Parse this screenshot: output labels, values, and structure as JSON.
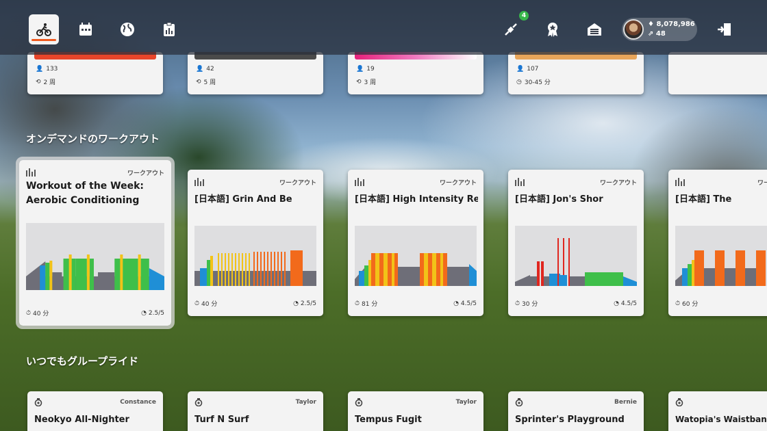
{
  "nav": {
    "notification_count": "4",
    "profile": {
      "drops": "8,078,986",
      "level": "48"
    }
  },
  "top_row": [
    {
      "participants": "133",
      "duration": "2 周",
      "strip_color": "#e8452a",
      "duration_icon": "repeat-icon"
    },
    {
      "participants": "42",
      "duration": "5 周",
      "strip_color": "#4a4a4a",
      "duration_icon": "repeat-icon"
    },
    {
      "participants": "19",
      "duration": "3 周",
      "strip_color": "#e6207a",
      "duration_icon": "repeat-icon"
    },
    {
      "participants": "107",
      "duration": "30-45 分",
      "strip_color": "#e8a55a",
      "duration_icon": "clock-icon"
    }
  ],
  "sections": {
    "workouts_title": "オンデマンドのワークアウト",
    "group_rides_title": "いつでもグループライド"
  },
  "workouts": [
    {
      "type": "ワークアウト",
      "title": "Workout of the Week: Aerobic Conditioning",
      "duration": "40 分",
      "difficulty": "2.5/5"
    },
    {
      "type": "ワークアウト",
      "title": "[日本語] Grin And Be",
      "duration": "40 分",
      "difficulty": "2.5/5"
    },
    {
      "type": "ワークアウト",
      "title": "[日本語] High Intensity Rec",
      "duration": "81 分",
      "difficulty": "4.5/5"
    },
    {
      "type": "ワークアウト",
      "title": "[日本語] Jon's Shor",
      "duration": "30 分",
      "difficulty": "4.5/5"
    },
    {
      "type": "ワー",
      "title": "[日本語] The",
      "duration": "60 分",
      "difficulty": ""
    }
  ],
  "group_rides": [
    {
      "host": "Constance",
      "title": "Neokyo All-Nighter"
    },
    {
      "host": "Taylor",
      "title": "Turf N Surf"
    },
    {
      "host": "Taylor",
      "title": "Tempus Fugit"
    },
    {
      "host": "Bernie",
      "title": "Sprinter's Playground"
    },
    {
      "host": "",
      "title": "Watopia's Waistband"
    }
  ],
  "colors": {
    "accent": "#f05a1f",
    "zone_gray": "#6e6e78",
    "zone_blue": "#1f8fd6",
    "zone_green": "#3fbf4a",
    "zone_yellow": "#f2c318",
    "zone_orange": "#f26a1b",
    "zone_red": "#e0261f"
  }
}
